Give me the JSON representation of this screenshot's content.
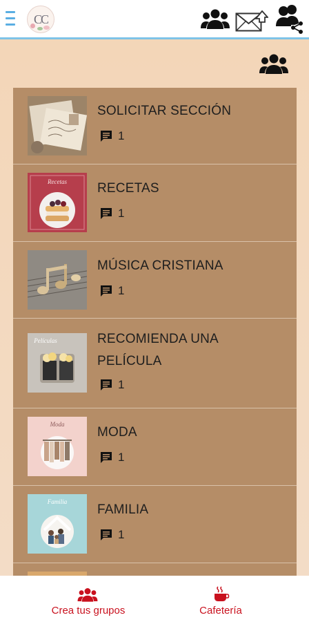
{
  "header": {
    "logo_text": "CC",
    "icons": [
      "menu-icon",
      "groups-icon",
      "mail-icon",
      "share-users-icon"
    ]
  },
  "groups_list": {
    "items": [
      {
        "title": "SOLICITAR SECCIÓN",
        "count": "1",
        "thumb": "postcard-image"
      },
      {
        "title": "RECETAS",
        "count": "1",
        "thumb_caption": "Recetas",
        "thumb": "cake-image"
      },
      {
        "title": "MÚSICA CRISTIANA",
        "count": "1",
        "thumb": "music-notes-image"
      },
      {
        "title_line1": "RECOMIENDA UNA",
        "title_line2": "PELÍCULA",
        "count": "1",
        "thumb_caption": "Películas",
        "thumb": "popcorn-image"
      },
      {
        "title": "MODA",
        "count": "1",
        "thumb_caption": "Moda",
        "thumb": "clothes-rack-image"
      },
      {
        "title": "FAMILIA",
        "count": "1",
        "thumb_caption": "Familia",
        "thumb": "family-image"
      }
    ]
  },
  "bottom_nav": {
    "groups_label": "Crea tus grupos",
    "cafe_label": "Cafetería"
  },
  "colors": {
    "accent": "#c9111e",
    "list_background": "#b58d67",
    "page_background": "#f3d9bd",
    "header_border": "#7ec3e8"
  }
}
